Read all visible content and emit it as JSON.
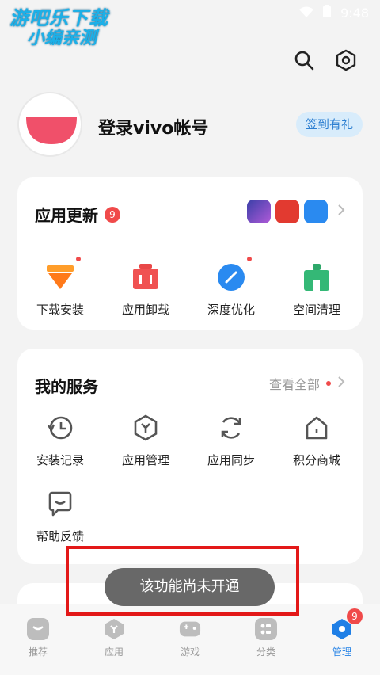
{
  "status": {
    "time": "9:48"
  },
  "watermark": {
    "line1": "游吧乐下载",
    "line2": "小编亲测"
  },
  "profile": {
    "login_label": "登录vivo帐号",
    "checkin_label": "签到有礼"
  },
  "app_update": {
    "title": "应用更新",
    "badge": "9",
    "actions": [
      {
        "label": "下载安装",
        "icon": "download-icon",
        "dot": true
      },
      {
        "label": "应用卸载",
        "icon": "trash-icon",
        "dot": false
      },
      {
        "label": "深度优化",
        "icon": "optimize-icon",
        "dot": true
      },
      {
        "label": "空间清理",
        "icon": "clean-icon",
        "dot": false
      }
    ]
  },
  "services": {
    "title": "我的服务",
    "view_all": "查看全部",
    "items": [
      {
        "label": "安装记录",
        "icon": "history-icon"
      },
      {
        "label": "应用管理",
        "icon": "app-manage-icon"
      },
      {
        "label": "应用同步",
        "icon": "sync-icon"
      },
      {
        "label": "积分商城",
        "icon": "store-icon"
      },
      {
        "label": "帮助反馈",
        "icon": "feedback-icon"
      }
    ]
  },
  "toast": {
    "text": "该功能尚未开通"
  },
  "nav": {
    "items": [
      {
        "label": "推荐"
      },
      {
        "label": "应用"
      },
      {
        "label": "游戏"
      },
      {
        "label": "分类"
      },
      {
        "label": "管理",
        "badge": "9"
      }
    ]
  },
  "colors": {
    "accent": "#1f7fe6",
    "badge": "#f04a4a",
    "highlight": "#e31818"
  }
}
